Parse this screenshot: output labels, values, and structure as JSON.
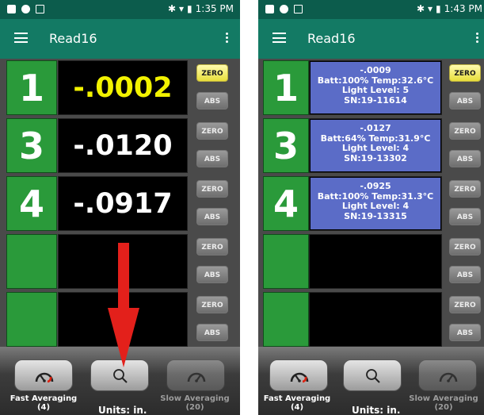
{
  "left": {
    "status_time": "1:35 PM",
    "app_title": "Read16",
    "slots": [
      {
        "number": "1",
        "reading": "-.0002",
        "highlight": true,
        "zero_label": "ZERO",
        "abs_label": "ABS"
      },
      {
        "number": "3",
        "reading": "-.0120",
        "highlight": false,
        "zero_label": "ZERO",
        "abs_label": "ABS"
      },
      {
        "number": "4",
        "reading": "-.0917",
        "highlight": false,
        "zero_label": "ZERO",
        "abs_label": "ABS"
      },
      {
        "number": "",
        "reading": "",
        "highlight": false,
        "zero_label": "ZERO",
        "abs_label": "ABS"
      },
      {
        "number": "",
        "reading": "",
        "highlight": false,
        "zero_label": "ZERO",
        "abs_label": "ABS"
      }
    ],
    "bottom": {
      "fast_label": "Fast Averaging",
      "fast_count": "(4)",
      "slow_label": "Slow Averaging",
      "slow_count": "(20)",
      "units": "Units: in."
    }
  },
  "right": {
    "status_time": "1:43 PM",
    "app_title": "Read16",
    "slots": [
      {
        "number": "1",
        "value": "-.0009",
        "line1": "Batt:100% Temp:32.6°C",
        "line2": "Light Level: 5",
        "line3": "SN:19-11614",
        "zero_label": "ZERO",
        "abs_label": "ABS"
      },
      {
        "number": "3",
        "value": "-.0127",
        "line1": "Batt:64% Temp:31.9°C",
        "line2": "Light Level: 4",
        "line3": "SN:19-13302",
        "zero_label": "ZERO",
        "abs_label": "ABS"
      },
      {
        "number": "4",
        "value": "-.0925",
        "line1": "Batt:100% Temp:31.3°C",
        "line2": "Light Level: 4",
        "line3": "SN:19-13315",
        "zero_label": "ZERO",
        "abs_label": "ABS"
      },
      {
        "number": "",
        "value": "",
        "zero_label": "ZERO",
        "abs_label": "ABS"
      },
      {
        "number": "",
        "value": "",
        "zero_label": "ZERO",
        "abs_label": "ABS"
      }
    ],
    "bottom": {
      "fast_label": "Fast Averaging",
      "fast_count": "(4)",
      "slow_label": "Slow Averaging",
      "slow_count": "(20)",
      "units": "Units: in."
    }
  },
  "colors": {
    "statusbar": "#0c5c4c",
    "appbar": "#137a64",
    "number_tile": "#2a9a3a",
    "info_panel": "#5b6cc7",
    "highlight_reading": "#f2f200",
    "annotation_arrow": "#e3201b"
  },
  "icons": [
    "menu-icon",
    "more-vert-icon",
    "bluetooth-icon",
    "wifi-icon",
    "battery-icon",
    "gauge-icon",
    "search-icon"
  ]
}
